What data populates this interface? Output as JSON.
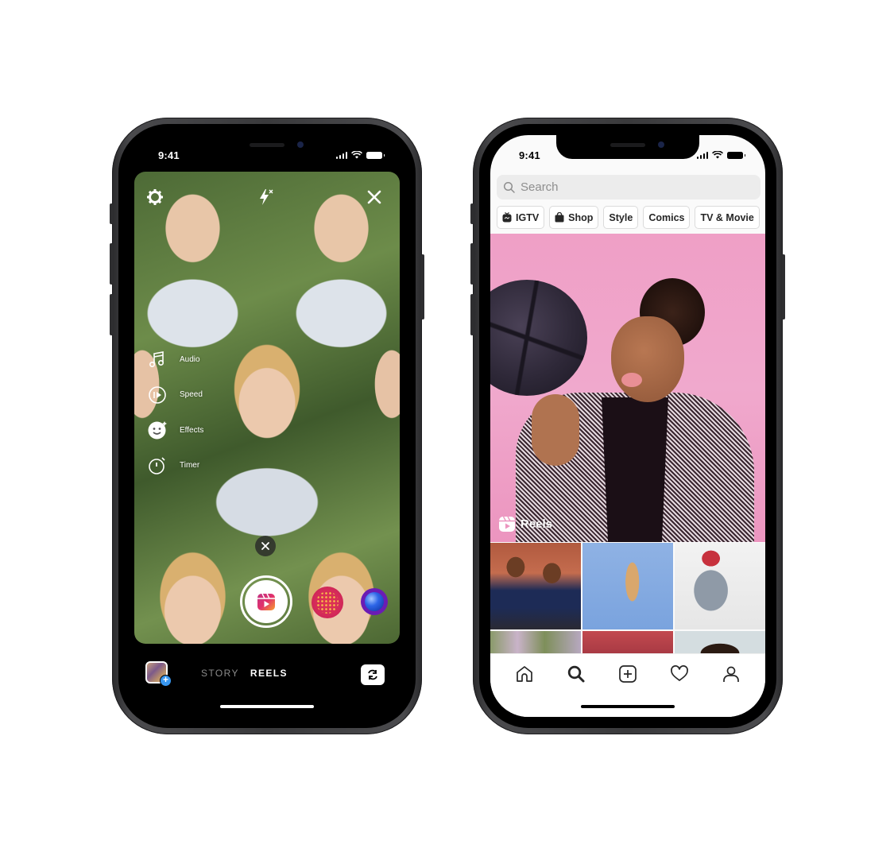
{
  "left_phone": {
    "status_time": "9:41",
    "top_controls": {
      "settings_icon": "gear-icon",
      "flash_icon": "flash-off-icon",
      "close_icon": "close-icon"
    },
    "side_tools": [
      {
        "icon": "music-note-icon",
        "label": "Audio"
      },
      {
        "icon": "speed-icon",
        "label": "Speed"
      },
      {
        "icon": "face-effect-icon",
        "label": "Effects"
      },
      {
        "icon": "timer-icon",
        "label": "Timer"
      }
    ],
    "capture": {
      "cancel_icon": "close-icon",
      "shutter_icon": "reels-icon",
      "effects": [
        "sparkle-effect",
        "blue-orb-effect"
      ]
    },
    "bottom": {
      "modes": [
        {
          "label": "STORY",
          "active": false
        },
        {
          "label": "REELS",
          "active": true
        }
      ],
      "gallery_badge": "+",
      "flip_camera_icon": "flip-camera-icon"
    }
  },
  "right_phone": {
    "status_time": "9:41",
    "search": {
      "placeholder": "Search"
    },
    "chips": [
      {
        "label": "IGTV",
        "icon": "igtv-icon"
      },
      {
        "label": "Shop",
        "icon": "shopping-bag-icon"
      },
      {
        "label": "Style",
        "icon": null
      },
      {
        "label": "Comics",
        "icon": null
      },
      {
        "label": "TV & Movie",
        "icon": null
      }
    ],
    "hero": {
      "label": "Reels",
      "icon": "reels-icon"
    },
    "tabbar": [
      {
        "name": "home",
        "icon": "home-icon",
        "active": false
      },
      {
        "name": "search",
        "icon": "search-icon",
        "active": true
      },
      {
        "name": "new-post",
        "icon": "add-post-icon",
        "active": false
      },
      {
        "name": "activity",
        "icon": "heart-icon",
        "active": false
      },
      {
        "name": "profile",
        "icon": "profile-icon",
        "active": false
      }
    ]
  },
  "colors": {
    "reels_gradient_start": "#f58529",
    "reels_gradient_end": "#c13584",
    "badge_blue": "#3897f0",
    "hero_pink": "#ef9fc6"
  }
}
